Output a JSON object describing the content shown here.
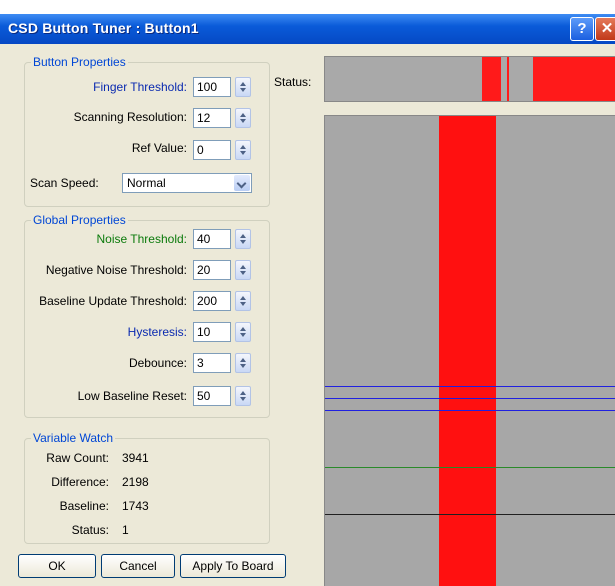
{
  "window": {
    "title": "CSD Button Tuner : Button1",
    "help_glyph": "?",
    "close_glyph": "✕"
  },
  "button_properties": {
    "title": "Button Properties",
    "finger_threshold": {
      "label": "Finger Threshold:",
      "value": "100"
    },
    "scanning_resolution": {
      "label": "Scanning Resolution:",
      "value": "12"
    },
    "ref_value": {
      "label": "Ref Value:",
      "value": "0"
    },
    "scan_speed": {
      "label": "Scan Speed:",
      "value": "Normal"
    }
  },
  "global_properties": {
    "title": "Global Properties",
    "noise_threshold": {
      "label": "Noise Threshold:",
      "value": "40"
    },
    "negative_noise_threshold": {
      "label": "Negative Noise Threshold:",
      "value": "20"
    },
    "baseline_update_threshold": {
      "label": "Baseline Update Threshold:",
      "value": "200"
    },
    "hysteresis": {
      "label": "Hysteresis:",
      "value": "10"
    },
    "debounce": {
      "label": "Debounce:",
      "value": "3"
    },
    "low_baseline_reset": {
      "label": "Low Baseline Reset:",
      "value": "50"
    }
  },
  "variable_watch": {
    "title": "Variable Watch",
    "raw_count": {
      "label": "Raw Count:",
      "value": "3941"
    },
    "difference": {
      "label": "Difference:",
      "value": "2198"
    },
    "baseline": {
      "label": "Baseline:",
      "value": "1743"
    },
    "status": {
      "label": "Status:",
      "value": "1"
    }
  },
  "buttons": {
    "ok": "OK",
    "cancel": "Cancel",
    "apply": "Apply To Board"
  },
  "status_area": {
    "label": "Status:"
  },
  "colors": {
    "signal": "#ff1010",
    "threshold_lines": "#2020e0",
    "noise_line": "#2a8a2a",
    "baseline_line": "#202020",
    "panel_background": "#a7a7a7"
  }
}
